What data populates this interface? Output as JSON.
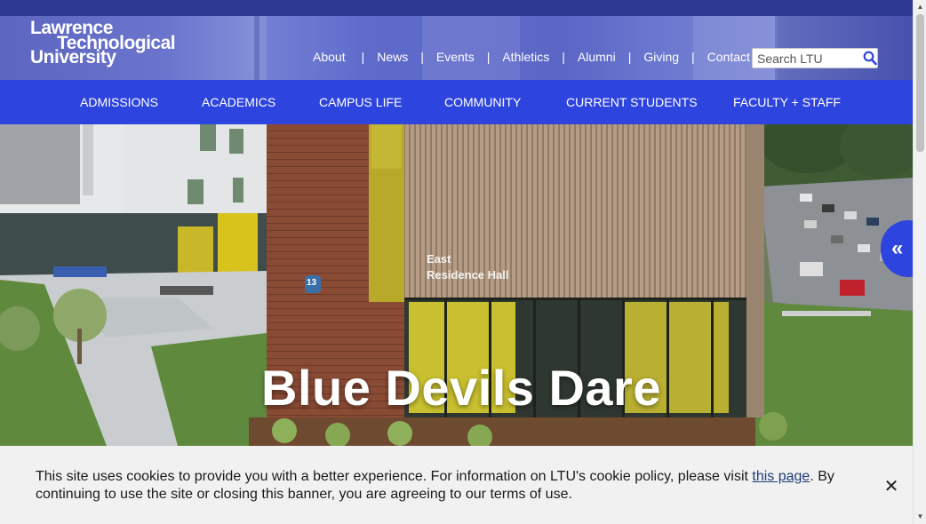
{
  "logo": {
    "line1": "Lawrence",
    "line2": "Technological",
    "line3": "University"
  },
  "utility_nav": {
    "items": [
      {
        "label": "About"
      },
      {
        "label": "News"
      },
      {
        "label": "Events"
      },
      {
        "label": "Athletics"
      },
      {
        "label": "Alumni"
      },
      {
        "label": "Giving"
      },
      {
        "label": "Contact"
      }
    ],
    "separator": "|"
  },
  "search": {
    "placeholder": "Search LTU",
    "icon": "search-icon"
  },
  "main_nav": {
    "items": [
      {
        "label": "ADMISSIONS"
      },
      {
        "label": "ACADEMICS"
      },
      {
        "label": "CAMPUS LIFE"
      },
      {
        "label": "COMMUNITY"
      },
      {
        "label": "CURRENT STUDENTS"
      },
      {
        "label": "FACULTY + STAFF"
      }
    ]
  },
  "hero": {
    "title": "Blue Devils Dare",
    "building_sign_line1": "East",
    "building_sign_line2": "Residence Hall",
    "building_number": "13",
    "side_toggle_icon": "«"
  },
  "cookie_banner": {
    "text_before_link": "This site uses cookies to provide you with a better experience. For information on LTU's cookie policy, please visit ",
    "link_text": "this page",
    "text_after_link": ". By continuing to use the site or closing this banner, you are agreeing to our terms of use.",
    "close_icon": "✕"
  },
  "colors": {
    "brand_blue": "#2e44de",
    "header_top": "#2c3a94",
    "banner_bg": "#f1f1f1",
    "link": "#1f3c7a"
  }
}
